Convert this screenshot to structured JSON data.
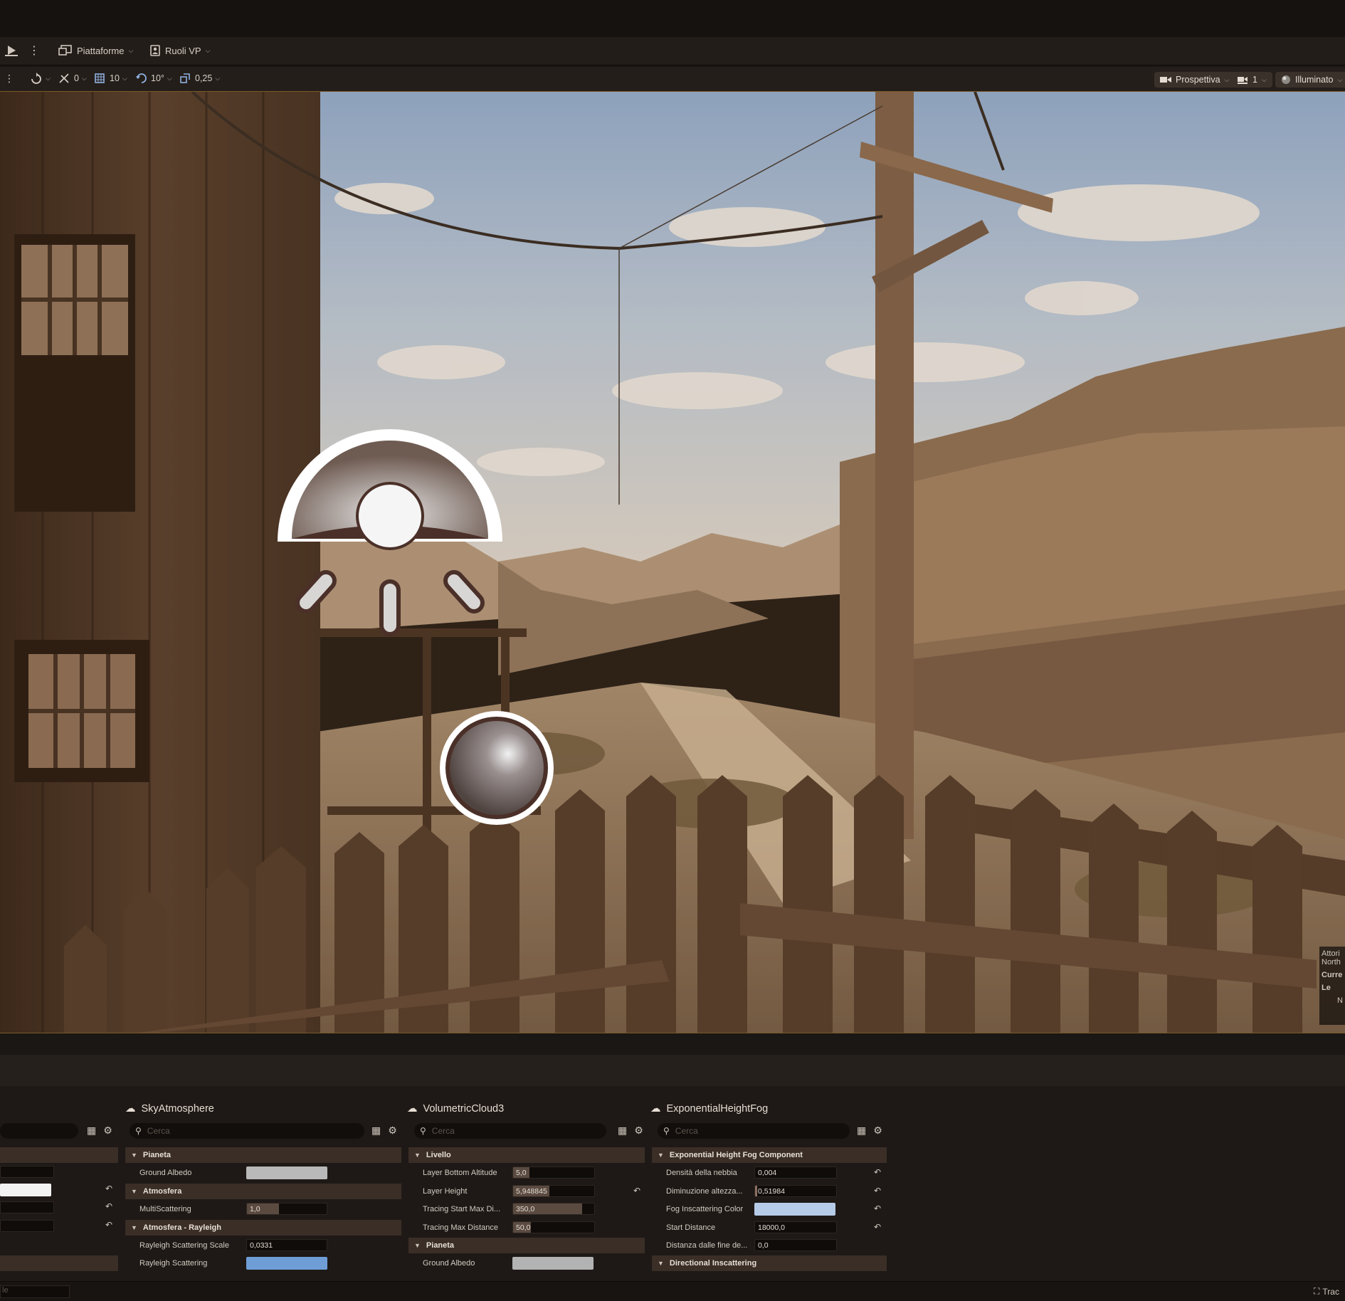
{
  "toolbar": {
    "platforms_label": "Piattaforme",
    "vp_roles_label": "Ruoli VP"
  },
  "viewport_bar": {
    "rotation_value": "0",
    "grid_value": "10",
    "angle_value": "10°",
    "scale_value": "0,25",
    "perspective_label": "Prospettiva",
    "camera_speed": "1",
    "view_mode_label": "Illuminato"
  },
  "viewport": {
    "overlay_lines": [
      "Attori",
      "North",
      "Curre",
      "Le",
      "N"
    ]
  },
  "panels": {
    "sky": {
      "title": "SkyAtmosphere",
      "search_placeholder": "Cerca",
      "sections": {
        "planet": "Pianeta",
        "atmosphere": "Atmosfera",
        "rayleigh": "Atmosfera - Rayleigh"
      },
      "rows": {
        "ground_albedo_label": "Ground Albedo",
        "multiscattering_label": "MultiScattering",
        "multiscattering_value": "1,0",
        "rayleigh_scale_label": "Rayleigh Scattering Scale",
        "rayleigh_scale_value": "0,0331",
        "rayleigh_scattering_label": "Rayleigh Scattering"
      },
      "colors": {
        "ground_albedo": "#b9b9b9",
        "rayleigh": "#6f9ed6"
      }
    },
    "cloud": {
      "title": "VolumetricCloud3",
      "search_placeholder": "Cerca",
      "sections": {
        "level": "Livello",
        "planet": "Pianeta"
      },
      "rows": {
        "layer_bottom_label": "Layer Bottom Altitude",
        "layer_bottom_value": "5,0",
        "layer_height_label": "Layer Height",
        "layer_height_value": "5,948845",
        "tracing_start_label": "Tracing Start Max Di...",
        "tracing_start_value": "350,0",
        "tracing_max_label": "Tracing Max Distance",
        "tracing_max_value": "50,0",
        "ground_albedo_label": "Ground Albedo"
      },
      "colors": {
        "ground_albedo": "#b3b3b3"
      }
    },
    "fog": {
      "title": "ExponentialHeightFog",
      "search_placeholder": "Cerca",
      "sections": {
        "component": "Exponential Height Fog Component",
        "directional": "Directional Inscattering"
      },
      "rows": {
        "density_label": "Densità della nebbia",
        "density_value": "0,004",
        "falloff_label": "Diminuzione altezza...",
        "falloff_value": "0,51984",
        "color_label": "Fog Inscattering Color",
        "start_label": "Start Distance",
        "start_value": "18000,0",
        "cutoff_label": "Distanza dalle fine de...",
        "cutoff_value": "0,0"
      },
      "colors": {
        "inscattering": "#b6cbe8"
      }
    }
  },
  "statusbar": {
    "input_text": "le",
    "right_label": "Trac"
  }
}
